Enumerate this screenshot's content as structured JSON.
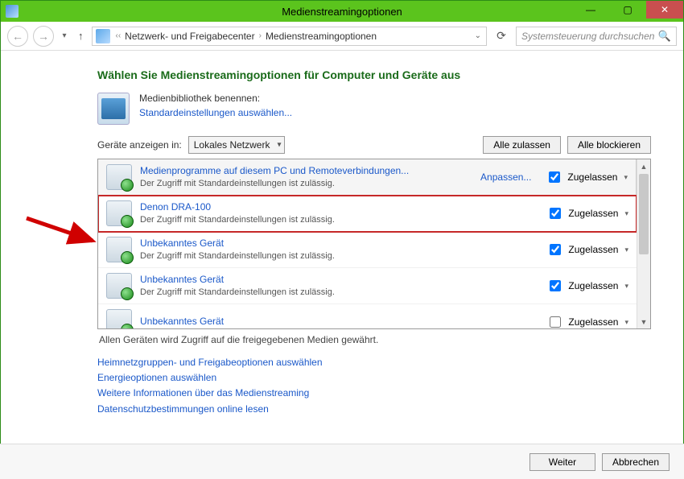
{
  "window": {
    "title": "Medienstreamingoptionen"
  },
  "nav": {
    "crumb1": "Netzwerk- und Freigabecenter",
    "crumb2": "Medienstreamingoptionen",
    "search_placeholder": "Systemsteuerung durchsuchen"
  },
  "main": {
    "heading": "Wählen Sie Medienstreamingoptionen für Computer und Geräte aus",
    "library_label": "Medienbibliothek benennen:",
    "library_link": "Standardeinstellungen auswählen...",
    "filter_label": "Geräte anzeigen in:",
    "filter_value": "Lokales Netzwerk",
    "allow_all": "Alle zulassen",
    "block_all": "Alle blockieren"
  },
  "devices": [
    {
      "name": "Medienprogramme auf diesem PC und Remoteverbindungen...",
      "desc": "Der Zugriff mit Standardeinstellungen ist zulässig.",
      "customize": "Anpassen...",
      "allowed_label": "Zugelassen",
      "allowed": true,
      "selected": true,
      "highlighted": false
    },
    {
      "name": "Denon DRA-100",
      "desc": "Der Zugriff mit Standardeinstellungen ist zulässig.",
      "customize": "",
      "allowed_label": "Zugelassen",
      "allowed": true,
      "selected": false,
      "highlighted": true
    },
    {
      "name": "Unbekanntes Gerät",
      "desc": "Der Zugriff mit Standardeinstellungen ist zulässig.",
      "customize": "",
      "allowed_label": "Zugelassen",
      "allowed": true,
      "selected": false,
      "highlighted": false
    },
    {
      "name": "Unbekanntes Gerät",
      "desc": "Der Zugriff mit Standardeinstellungen ist zulässig.",
      "customize": "",
      "allowed_label": "Zugelassen",
      "allowed": true,
      "selected": false,
      "highlighted": false
    },
    {
      "name": "Unbekanntes Gerät",
      "desc": "",
      "customize": "",
      "allowed_label": "Zugelassen",
      "allowed": false,
      "selected": false,
      "highlighted": false
    }
  ],
  "status_line": "Allen Geräten wird Zugriff auf die freigegebenen Medien gewährt.",
  "links": {
    "l1": "Heimnetzgruppen- und Freigabeoptionen auswählen",
    "l2": "Energieoptionen auswählen",
    "l3": "Weitere Informationen über das Medienstreaming",
    "l4": "Datenschutzbestimmungen online lesen"
  },
  "footer": {
    "next": "Weiter",
    "cancel": "Abbrechen"
  },
  "colors": {
    "accent": "#5bc41d",
    "heading": "#1a6b1a",
    "link": "#1a58c9",
    "highlight": "#c62828"
  }
}
